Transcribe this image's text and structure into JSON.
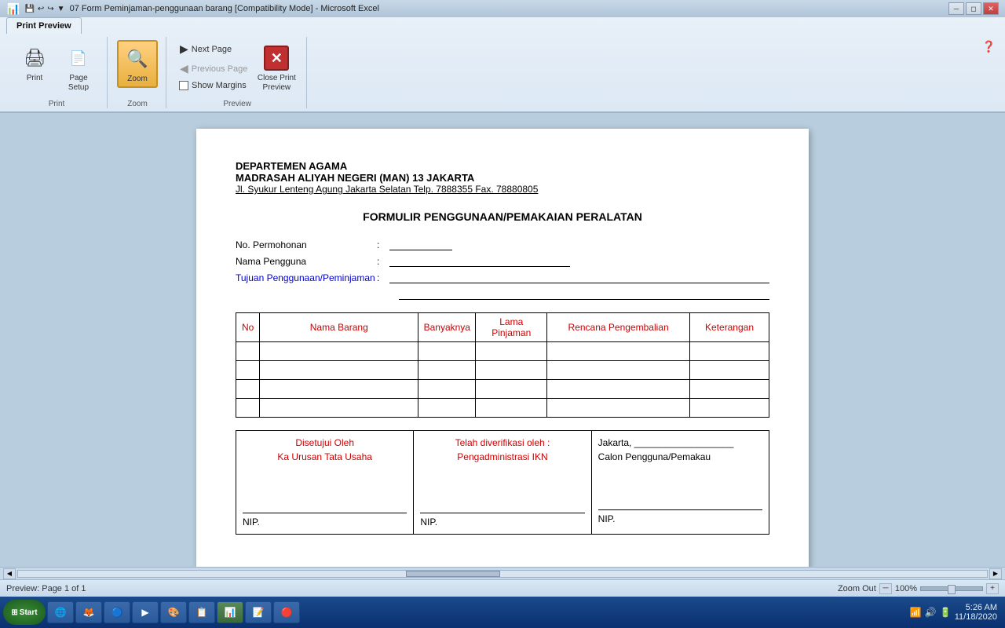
{
  "window": {
    "title": "07 Form Peminjaman-penggunaan barang  [Compatibility Mode] - Microsoft Excel",
    "help_icon": "❓"
  },
  "quickaccess": {
    "save_icon": "💾",
    "undo_icon": "↩",
    "redo_icon": "↪",
    "dropdown_icon": "▼"
  },
  "ribbon": {
    "tabs": [
      {
        "label": "Print Preview",
        "active": true
      }
    ],
    "groups": {
      "print": {
        "label": "Print",
        "print_btn": "Print",
        "page_setup_btn": "Page\nSetup",
        "print_icon": "🖨",
        "page_setup_icon": "📄"
      },
      "zoom": {
        "label": "Zoom",
        "zoom_btn": "Zoom",
        "zoom_icon": "🔍"
      },
      "preview": {
        "label": "Preview",
        "next_page": "Next Page",
        "previous_page": "Previous Page",
        "show_margins": "Show Margins",
        "close_label": "Close Print\nPreview",
        "next_disabled": false,
        "prev_disabled": true,
        "margins_checked": false
      }
    }
  },
  "form": {
    "org_line1": "DEPARTEMEN AGAMA",
    "org_line2": "MADRASAH ALIYAH NEGERI (MAN) 13 JAKARTA",
    "address": "Jl. Syukur Lenteng Agung Jakarta Selatan Telp. 7888355 Fax. 78880805",
    "title": "FORMULIR PENGGUNAAN/PEMAKAIAN PERALATAN",
    "field_no_label": "No. Permohonan",
    "field_nama_label": "Nama Pengguna",
    "field_tujuan_label": "Tujuan Penggunaan/Peminjaman",
    "colon": ":",
    "table": {
      "headers": [
        "No",
        "Nama Barang",
        "Banyaknya",
        "Lama Pinjaman",
        "Rencana Pengembalian",
        "Keterangan"
      ],
      "rows": [
        [
          "",
          "",
          "",
          "",
          "",
          ""
        ],
        [
          "",
          "",
          "",
          "",
          "",
          ""
        ],
        [
          "",
          "",
          "",
          "",
          "",
          ""
        ],
        [
          "",
          "",
          "",
          "",
          "",
          ""
        ]
      ]
    },
    "signature": {
      "col1_line1": "Disetujui Oleh",
      "col1_line2": "Ka Urusan Tata Usaha",
      "col2_line1": "Telah diverifikasi oleh :",
      "col2_line2": "Pengadministrasi IKN",
      "col3_line1": "Jakarta, ___________________",
      "col3_line2": "Calon Pengguna/Pemakau",
      "nip": "NIP."
    }
  },
  "statusbar": {
    "preview_info": "Preview: Page 1 of 1",
    "zoom_label": "Zoom Out",
    "zoom_percent": "100%",
    "zoom_in_label": "Zoom In"
  },
  "taskbar": {
    "start_label": "Start",
    "apps": [
      {
        "icon": "🌐",
        "label": ""
      },
      {
        "icon": "🔵",
        "label": ""
      },
      {
        "icon": "🟠",
        "label": ""
      },
      {
        "icon": "▶",
        "label": ""
      },
      {
        "icon": "🎨",
        "label": ""
      },
      {
        "icon": "📋",
        "label": ""
      },
      {
        "icon": "📊",
        "label": ""
      },
      {
        "icon": "📝",
        "label": ""
      },
      {
        "icon": "🔴",
        "label": ""
      }
    ],
    "tray_time": "5:26 AM",
    "tray_date": "11/18/2020"
  },
  "colors": {
    "accent_blue": "#0000cc",
    "accent_red": "#cc0000",
    "header_red": "#cc0000",
    "ribbon_bg": "#dce8f4",
    "preview_bg": "#b8cede"
  }
}
